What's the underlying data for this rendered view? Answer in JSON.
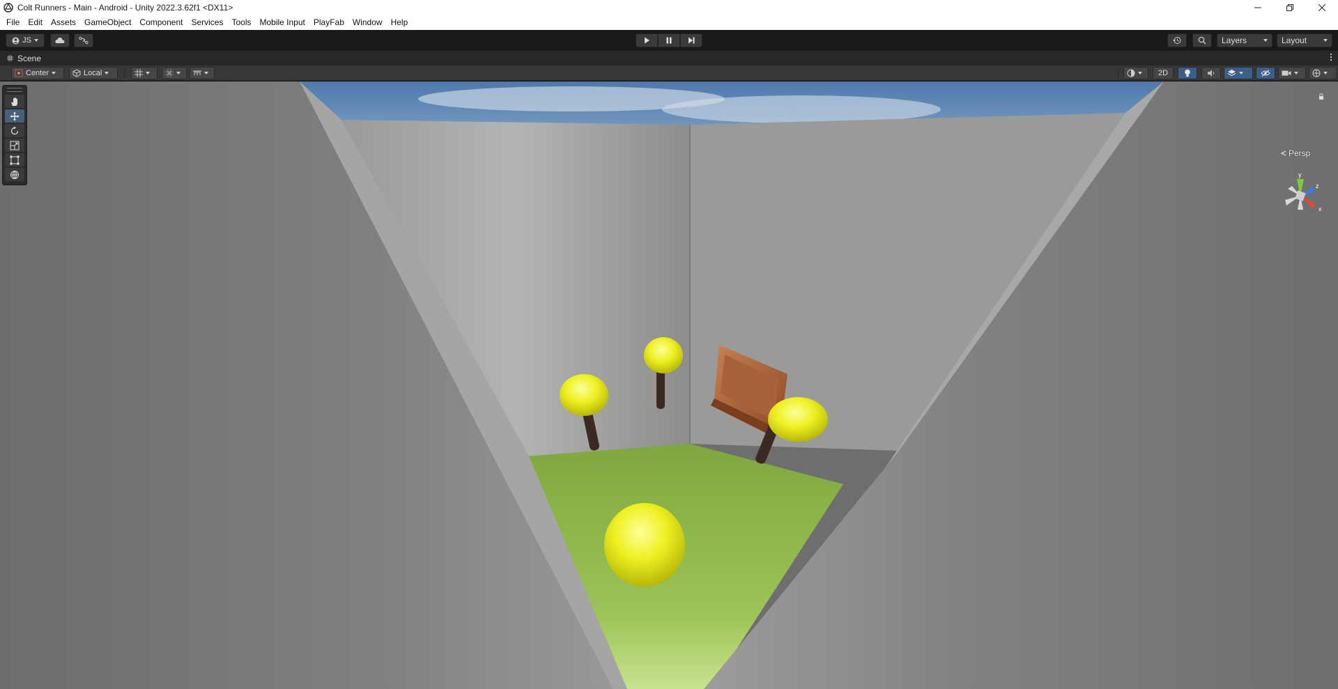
{
  "window": {
    "title": "Colt Runners - Main - Android - Unity 2022.3.62f1 <DX11>",
    "controls": [
      "minimize-icon",
      "restore-icon",
      "close-icon"
    ]
  },
  "menubar": {
    "items": [
      "File",
      "Edit",
      "Assets",
      "GameObject",
      "Component",
      "Services",
      "Tools",
      "Mobile Input",
      "PlayFab",
      "Window",
      "Help"
    ]
  },
  "toolbar": {
    "account_label": "JS",
    "layers_label": "Layers",
    "layout_label": "Layout",
    "play_icons": [
      "play-icon",
      "pause-icon",
      "step-icon"
    ]
  },
  "scene_tab": {
    "label": "Scene",
    "icon": "grid-hash-icon"
  },
  "scene_toolbar": {
    "pivot_label": "Center",
    "space_label": "Local",
    "mode_2d_label": "2D"
  },
  "tools_palette": {
    "tools": [
      "hand-tool",
      "move-tool",
      "rotate-tool",
      "scale-tool",
      "rect-tool",
      "transform-tool"
    ],
    "active_tool": "move-tool"
  },
  "scene_view": {
    "projection_label": "Persp",
    "gizmo_axes": {
      "y": "y",
      "z": "z",
      "x": "x"
    },
    "colors": {
      "sky": "#5f87b5",
      "wall": "#8a8a8a",
      "grass": "#7aa83c",
      "mushroom_cap": "#e8ec1e",
      "stem": "#3a2a22",
      "crate": "#b86a3c",
      "axis_y": "#7fcb3a",
      "axis_z": "#3a7fe0",
      "axis_x": "#e04a3a",
      "highlight_blue": "#3c5f8a"
    }
  }
}
